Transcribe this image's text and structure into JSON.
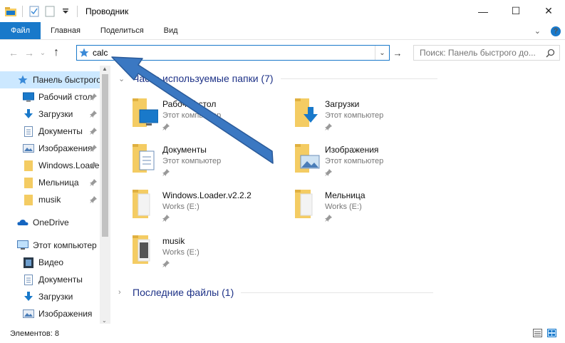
{
  "window": {
    "title": "Проводник",
    "minimize": "—",
    "maximize": "☐",
    "close": "✕"
  },
  "ribbon": {
    "tabs": [
      "Файл",
      "Главная",
      "Поделиться",
      "Вид"
    ],
    "collapse_glyph": "⌄",
    "help_glyph": "?"
  },
  "address": {
    "back_glyph": "←",
    "forward_glyph": "→",
    "history_glyph": "⌄",
    "up_glyph": "↑",
    "value": "calc",
    "dropdown_glyph": "⌄",
    "go_glyph": "→"
  },
  "search": {
    "placeholder": "Поиск: Панель быстрого до..."
  },
  "nav": {
    "quick_access": "Панель быстрого доступа",
    "items": [
      {
        "label": "Рабочий стол",
        "icon": "desktop-icon"
      },
      {
        "label": "Загрузки",
        "icon": "download-icon"
      },
      {
        "label": "Документы",
        "icon": "documents-icon"
      },
      {
        "label": "Изображения",
        "icon": "pictures-icon"
      },
      {
        "label": "Windows.Loader",
        "icon": "folder-icon"
      },
      {
        "label": "Мельница",
        "icon": "folder-icon"
      },
      {
        "label": "musik",
        "icon": "folder-icon"
      }
    ],
    "onedrive": "OneDrive",
    "this_pc": "Этот компьютер",
    "pc_items": [
      {
        "label": "Видео",
        "icon": "video-icon"
      },
      {
        "label": "Документы",
        "icon": "documents-icon"
      },
      {
        "label": "Загрузки",
        "icon": "download-icon"
      },
      {
        "label": "Изображения",
        "icon": "pictures-icon"
      }
    ]
  },
  "frequent": {
    "header": "Часто используемые папки (7)",
    "folders": [
      {
        "name": "Рабочий стол",
        "location": "Этот компьютер",
        "icon": "desktop-folder-icon"
      },
      {
        "name": "Загрузки",
        "location": "Этот компьютер",
        "icon": "downloads-folder-icon"
      },
      {
        "name": "Документы",
        "location": "Этот компьютер",
        "icon": "documents-folder-icon"
      },
      {
        "name": "Изображения",
        "location": "Этот компьютер",
        "icon": "pictures-folder-icon"
      },
      {
        "name": "Windows.Loader.v2.2.2",
        "location": "Works (E:)",
        "icon": "folder-icon"
      },
      {
        "name": "Мельница",
        "location": "Works (E:)",
        "icon": "folder-icon"
      },
      {
        "name": "musik",
        "location": "Works (E:)",
        "icon": "folder-icon"
      }
    ]
  },
  "recent": {
    "header": "Последние файлы (1)"
  },
  "status": {
    "items": "Элементов: 8"
  },
  "colors": {
    "accent": "#1979ca",
    "selection": "#cce8ff",
    "folder": "#f4cc63",
    "arrow": "#3b78c2"
  }
}
